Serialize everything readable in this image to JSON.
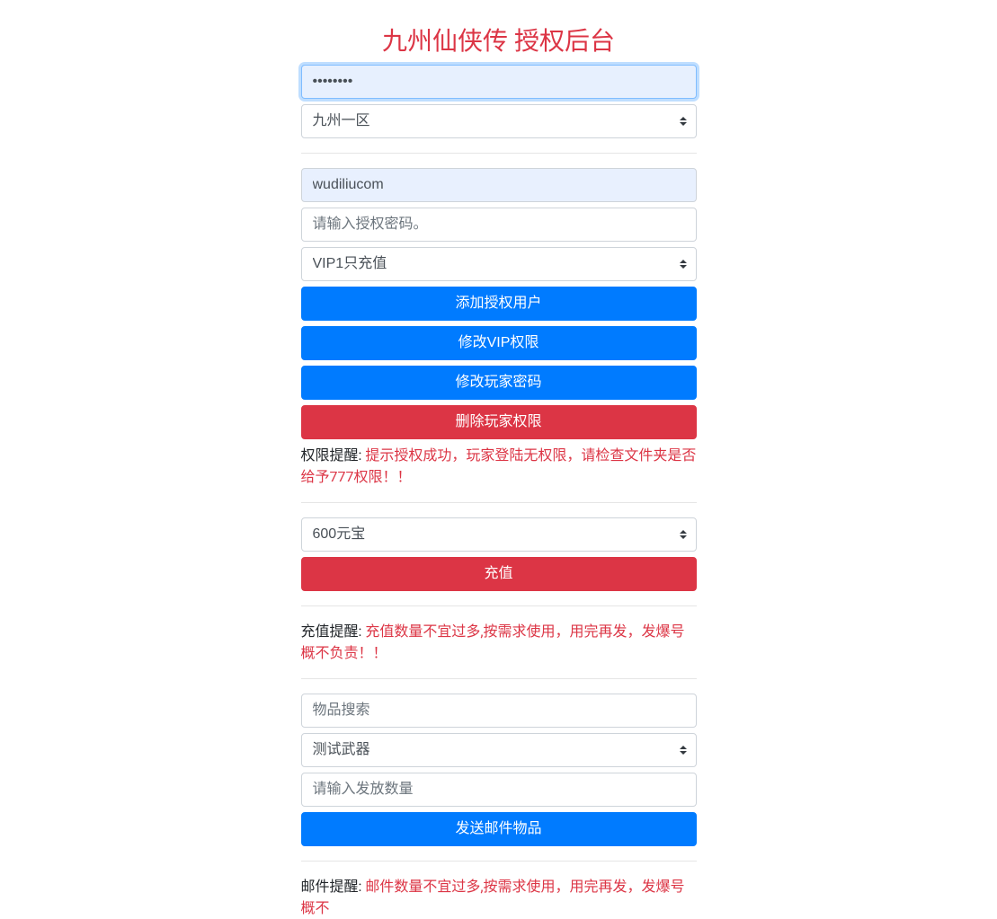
{
  "title": "九州仙侠传 授权后台",
  "section1": {
    "password_value": "••••••••",
    "server_selected": "九州一区"
  },
  "section2": {
    "username_value": "wudiliucom",
    "auth_password_placeholder": "请输入授权密码。",
    "vip_selected": "VIP1只充值",
    "add_auth_user_btn": "添加授权用户",
    "modify_vip_btn": "修改VIP权限",
    "modify_password_btn": "修改玩家密码",
    "delete_player_btn": "删除玩家权限",
    "reminder_label": "权限提醒: ",
    "reminder_text": "提示授权成功，玩家登陆无权限，请检查文件夹是否给予777权限！！"
  },
  "section3": {
    "yuanbao_selected": "600元宝",
    "recharge_btn": "充值",
    "reminder_label": "充值提醒: ",
    "reminder_text": "充值数量不宜过多,按需求使用，用完再发，发爆号概不负责！！"
  },
  "section4": {
    "item_search_placeholder": "物品搜索",
    "item_selected": "测试武器",
    "quantity_placeholder": "请输入发放数量",
    "send_mail_btn": "发送邮件物品",
    "reminder_label": "邮件提醒: ",
    "reminder_text": "邮件数量不宜过多,按需求使用，用完再发，发爆号概不"
  }
}
